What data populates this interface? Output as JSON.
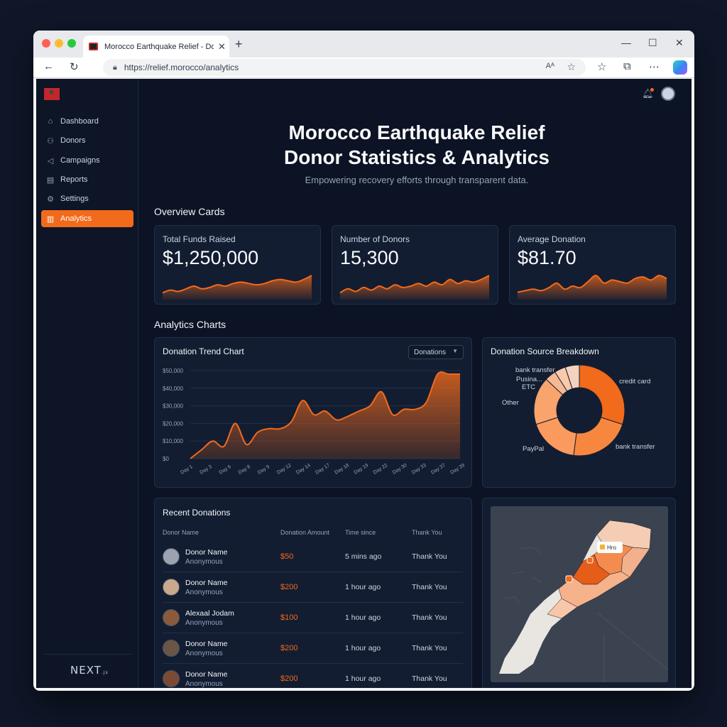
{
  "browser": {
    "tab_title": "Morocco Earthquake Relief - Don",
    "url": "https://relief.morocco/analytics",
    "reader_label": "Aᴬ"
  },
  "sidebar": {
    "items": [
      {
        "label": "Dashboard",
        "icon": "home-icon"
      },
      {
        "label": "Donors",
        "icon": "users-icon"
      },
      {
        "label": "Campaigns",
        "icon": "megaphone-icon"
      },
      {
        "label": "Reports",
        "icon": "document-icon"
      },
      {
        "label": "Settings",
        "icon": "gear-icon"
      },
      {
        "label": "Analytics",
        "icon": "bar-chart-icon",
        "active": true
      }
    ],
    "footer_logo": "NEXT",
    "footer_logo_suffix": ".js"
  },
  "hero": {
    "title_line1": "Morocco Earthquake Relief",
    "title_line2": "Donor Statistics & Analytics",
    "subtitle": "Empowering recovery efforts through transparent data."
  },
  "overview": {
    "heading": "Overview Cards",
    "cards": [
      {
        "label": "Total Funds Raised",
        "value": "$1,250,000"
      },
      {
        "label": "Number of Donors",
        "value": "15,300"
      },
      {
        "label": "Average Donation",
        "value": "$81.70"
      }
    ]
  },
  "analytics": {
    "heading": "Analytics Charts",
    "trend_title": "Donation Trend Chart",
    "trend_dropdown": "Donations",
    "breakdown_title": "Donation Source Breakdown"
  },
  "recent": {
    "title": "Recent Donations",
    "headers": [
      "Donor Name",
      "Donation Amount",
      "Time since",
      "Thank You"
    ],
    "rows": [
      {
        "name": "Donor Name",
        "sub": "Anonymous",
        "amount": "$50",
        "time": "5 mins ago",
        "thanks": "Thank You"
      },
      {
        "name": "Donor Name",
        "sub": "Anonymous",
        "amount": "$200",
        "time": "1 hour ago",
        "thanks": "Thank You"
      },
      {
        "name": "Alexaal Jodam",
        "sub": "Anonymous",
        "amount": "$100",
        "time": "1 hour ago",
        "thanks": "Thank You"
      },
      {
        "name": "Donor Name",
        "sub": "Anonymous",
        "amount": "$200",
        "time": "1 hour ago",
        "thanks": "Thank You"
      },
      {
        "name": "Donor Name",
        "sub": "Anonymous",
        "amount": "$200",
        "time": "1 hour ago",
        "thanks": "Thank You"
      }
    ]
  },
  "map": {
    "marker_label": "Hro"
  },
  "colors": {
    "accent": "#f26a1b",
    "background": "#0b1324",
    "card": "#131d31"
  },
  "chart_data": [
    {
      "type": "area",
      "title": "Donation Trend Chart",
      "categories": [
        "Day 1",
        "Day 3",
        "Day 6",
        "Day 8",
        "Day 9",
        "Day 12",
        "Day 14",
        "Day 17",
        "Day 18",
        "Day 19",
        "Day 22",
        "Day 30",
        "Day 33",
        "Day 37",
        "Day 39"
      ],
      "x": [
        0,
        2,
        4,
        6,
        8,
        10,
        12,
        14,
        16,
        18,
        20,
        22,
        24,
        26,
        28,
        30,
        32,
        34,
        36,
        38,
        40,
        42,
        44,
        46,
        48
      ],
      "values": [
        0,
        5000,
        10000,
        7000,
        20000,
        8000,
        15000,
        17000,
        17000,
        21000,
        33000,
        25000,
        27000,
        22000,
        24000,
        27000,
        30000,
        38000,
        25000,
        28000,
        28000,
        32000,
        48000,
        48000,
        48000
      ],
      "yticks": [
        "$0",
        "$10,000",
        "$20,000",
        "$30,000",
        "$40,000",
        "$50,000"
      ],
      "ylim": [
        0,
        50000
      ],
      "grid": true
    },
    {
      "type": "pie",
      "title": "Donation Source Breakdown",
      "donut": true,
      "slices": [
        {
          "label": "credit card",
          "value": 30
        },
        {
          "label": "bank transfer",
          "value": 22
        },
        {
          "label": "PayPal",
          "value": 18
        },
        {
          "label": "Other",
          "value": 17
        },
        {
          "label": "ETC",
          "value": 4
        },
        {
          "label": "Pusina...",
          "value": 4
        },
        {
          "label": "bank transfer",
          "value": 5
        }
      ]
    },
    {
      "type": "area",
      "series": [
        {
          "values": [
            3,
            5,
            4,
            6,
            8,
            6,
            7,
            9,
            8,
            10,
            11,
            10,
            9,
            10,
            12,
            13,
            12,
            11,
            13,
            16
          ]
        },
        {
          "values": [
            3,
            6,
            4,
            7,
            5,
            8,
            6,
            9,
            7,
            8,
            10,
            8,
            11,
            9,
            13,
            10,
            12,
            11,
            13,
            16
          ]
        },
        {
          "values": [
            3,
            4,
            5,
            4,
            6,
            9,
            5,
            7,
            6,
            10,
            14,
            9,
            11,
            10,
            9,
            12,
            13,
            11,
            14,
            12
          ]
        }
      ]
    }
  ]
}
